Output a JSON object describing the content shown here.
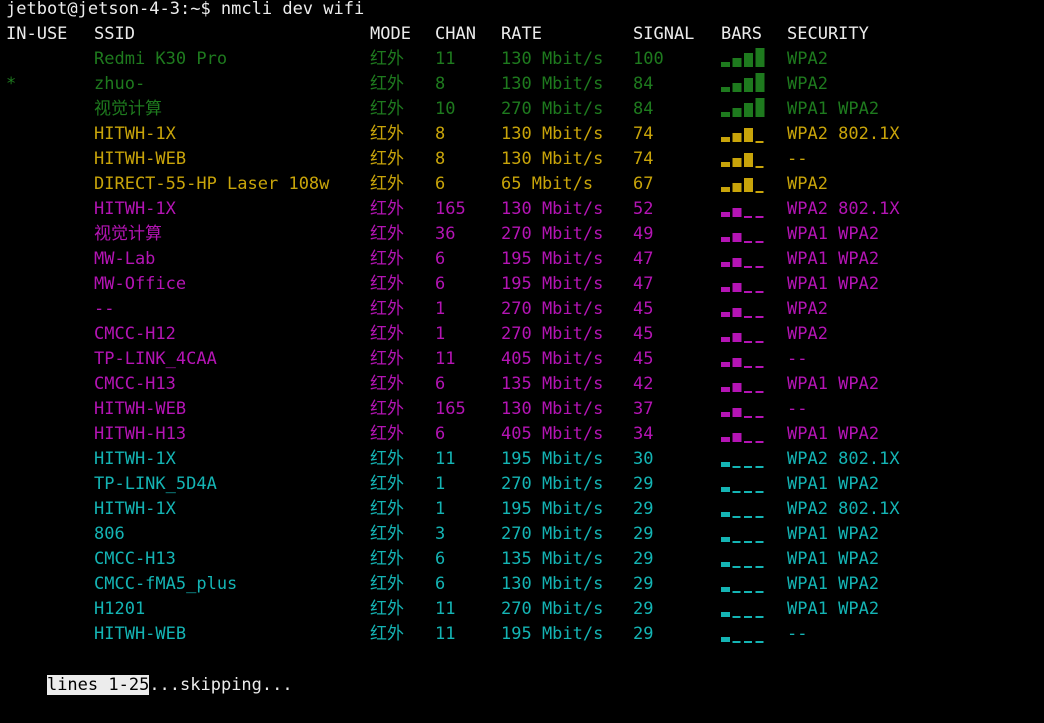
{
  "prompt": "jetbot@jetson-4-3:~$ nmcli dev wifi",
  "headers": {
    "in_use": "IN-USE",
    "ssid": "SSID",
    "mode": "MODE",
    "chan": "CHAN",
    "rate": "RATE",
    "signal": "SIGNAL",
    "bars": "BARS",
    "security": "SECURITY"
  },
  "colors": {
    "green": "#1e7a1e",
    "yellow": "#c8a40a",
    "magenta": "#b414b4",
    "cyan": "#14b4b4",
    "dim_bar": "#9a9a9a"
  },
  "networks": [
    {
      "in_use": "",
      "ssid": "Redmi K30 Pro",
      "mode": "红外",
      "chan": "11",
      "rate": "130 Mbit/s",
      "signal": "100",
      "bars_level": 4,
      "bars_icon": "signal-bars-4-icon",
      "security": "WPA2",
      "color": "green"
    },
    {
      "in_use": "*",
      "ssid": "zhuo-",
      "mode": "红外",
      "chan": "8",
      "rate": "130 Mbit/s",
      "signal": "84",
      "bars_level": 4,
      "bars_icon": "signal-bars-4-icon",
      "security": "WPA2",
      "color": "green"
    },
    {
      "in_use": "",
      "ssid": "视觉计算",
      "mode": "红外",
      "chan": "10",
      "rate": "270 Mbit/s",
      "signal": "84",
      "bars_level": 4,
      "bars_icon": "signal-bars-4-icon",
      "security": "WPA1 WPA2",
      "color": "green"
    },
    {
      "in_use": "",
      "ssid": "HITWH-1X",
      "mode": "红外",
      "chan": "8",
      "rate": "130 Mbit/s",
      "signal": "74",
      "bars_level": 3,
      "bars_icon": "signal-bars-3-icon",
      "security": "WPA2 802.1X",
      "color": "yellow"
    },
    {
      "in_use": "",
      "ssid": "HITWH-WEB",
      "mode": "红外",
      "chan": "8",
      "rate": "130 Mbit/s",
      "signal": "74",
      "bars_level": 3,
      "bars_icon": "signal-bars-3-icon",
      "security": "--",
      "color": "yellow"
    },
    {
      "in_use": "",
      "ssid": "DIRECT-55-HP Laser 108w",
      "mode": "红外",
      "chan": "6",
      "rate": "65 Mbit/s",
      "signal": "67",
      "bars_level": 3,
      "bars_icon": "signal-bars-3-icon",
      "security": "WPA2",
      "color": "yellow"
    },
    {
      "in_use": "",
      "ssid": "HITWH-1X",
      "mode": "红外",
      "chan": "165",
      "rate": "130 Mbit/s",
      "signal": "52",
      "bars_level": 2,
      "bars_icon": "signal-bars-2-icon",
      "security": "WPA2 802.1X",
      "color": "magenta"
    },
    {
      "in_use": "",
      "ssid": "视觉计算",
      "mode": "红外",
      "chan": "36",
      "rate": "270 Mbit/s",
      "signal": "49",
      "bars_level": 2,
      "bars_icon": "signal-bars-2-icon",
      "security": "WPA1 WPA2",
      "color": "magenta"
    },
    {
      "in_use": "",
      "ssid": "MW-Lab",
      "mode": "红外",
      "chan": "6",
      "rate": "195 Mbit/s",
      "signal": "47",
      "bars_level": 2,
      "bars_icon": "signal-bars-2-icon",
      "security": "WPA1 WPA2",
      "color": "magenta"
    },
    {
      "in_use": "",
      "ssid": "MW-Office",
      "mode": "红外",
      "chan": "6",
      "rate": "195 Mbit/s",
      "signal": "47",
      "bars_level": 2,
      "bars_icon": "signal-bars-2-icon",
      "security": "WPA1 WPA2",
      "color": "magenta"
    },
    {
      "in_use": "",
      "ssid": "--",
      "mode": "红外",
      "chan": "1",
      "rate": "270 Mbit/s",
      "signal": "45",
      "bars_level": 2,
      "bars_icon": "signal-bars-2-icon",
      "security": "WPA2",
      "color": "magenta"
    },
    {
      "in_use": "",
      "ssid": "CMCC-H12",
      "mode": "红外",
      "chan": "1",
      "rate": "270 Mbit/s",
      "signal": "45",
      "bars_level": 2,
      "bars_icon": "signal-bars-2-icon",
      "security": "WPA2",
      "color": "magenta"
    },
    {
      "in_use": "",
      "ssid": "TP-LINK_4CAA",
      "mode": "红外",
      "chan": "11",
      "rate": "405 Mbit/s",
      "signal": "45",
      "bars_level": 2,
      "bars_icon": "signal-bars-2-icon",
      "security": "--",
      "color": "magenta"
    },
    {
      "in_use": "",
      "ssid": "CMCC-H13",
      "mode": "红外",
      "chan": "6",
      "rate": "135 Mbit/s",
      "signal": "42",
      "bars_level": 2,
      "bars_icon": "signal-bars-2-icon",
      "security": "WPA1 WPA2",
      "color": "magenta"
    },
    {
      "in_use": "",
      "ssid": "HITWH-WEB",
      "mode": "红外",
      "chan": "165",
      "rate": "130 Mbit/s",
      "signal": "37",
      "bars_level": 2,
      "bars_icon": "signal-bars-2-icon",
      "security": "--",
      "color": "magenta"
    },
    {
      "in_use": "",
      "ssid": "HITWH-H13",
      "mode": "红外",
      "chan": "6",
      "rate": "405 Mbit/s",
      "signal": "34",
      "bars_level": 2,
      "bars_icon": "signal-bars-2-icon",
      "security": "WPA1 WPA2",
      "color": "magenta"
    },
    {
      "in_use": "",
      "ssid": "HITWH-1X",
      "mode": "红外",
      "chan": "11",
      "rate": "195 Mbit/s",
      "signal": "30",
      "bars_level": 1,
      "bars_icon": "signal-bars-1-icon",
      "security": "WPA2 802.1X",
      "color": "cyan"
    },
    {
      "in_use": "",
      "ssid": "TP-LINK_5D4A",
      "mode": "红外",
      "chan": "1",
      "rate": "270 Mbit/s",
      "signal": "29",
      "bars_level": 1,
      "bars_icon": "signal-bars-1-icon",
      "security": "WPA1 WPA2",
      "color": "cyan"
    },
    {
      "in_use": "",
      "ssid": "HITWH-1X",
      "mode": "红外",
      "chan": "1",
      "rate": "195 Mbit/s",
      "signal": "29",
      "bars_level": 1,
      "bars_icon": "signal-bars-1-icon",
      "security": "WPA2 802.1X",
      "color": "cyan"
    },
    {
      "in_use": "",
      "ssid": "806",
      "mode": "红外",
      "chan": "3",
      "rate": "270 Mbit/s",
      "signal": "29",
      "bars_level": 1,
      "bars_icon": "signal-bars-1-icon",
      "security": "WPA1 WPA2",
      "color": "cyan"
    },
    {
      "in_use": "",
      "ssid": "CMCC-H13",
      "mode": "红外",
      "chan": "6",
      "rate": "135 Mbit/s",
      "signal": "29",
      "bars_level": 1,
      "bars_icon": "signal-bars-1-icon",
      "security": "WPA1 WPA2",
      "color": "cyan"
    },
    {
      "in_use": "",
      "ssid": "CMCC-fMA5_plus",
      "mode": "红外",
      "chan": "6",
      "rate": "130 Mbit/s",
      "signal": "29",
      "bars_level": 1,
      "bars_icon": "signal-bars-1-icon",
      "security": "WPA1 WPA2",
      "color": "cyan"
    },
    {
      "in_use": "",
      "ssid": "H1201",
      "mode": "红外",
      "chan": "11",
      "rate": "270 Mbit/s",
      "signal": "29",
      "bars_level": 1,
      "bars_icon": "signal-bars-1-icon",
      "security": "WPA1 WPA2",
      "color": "cyan"
    },
    {
      "in_use": "",
      "ssid": "HITWH-WEB",
      "mode": "红外",
      "chan": "11",
      "rate": "195 Mbit/s",
      "signal": "29",
      "bars_level": 1,
      "bars_icon": "signal-bars-1-icon",
      "security": "--",
      "color": "cyan"
    }
  ],
  "pager": {
    "highlight": "lines 1-25",
    "rest": "...skipping..."
  }
}
